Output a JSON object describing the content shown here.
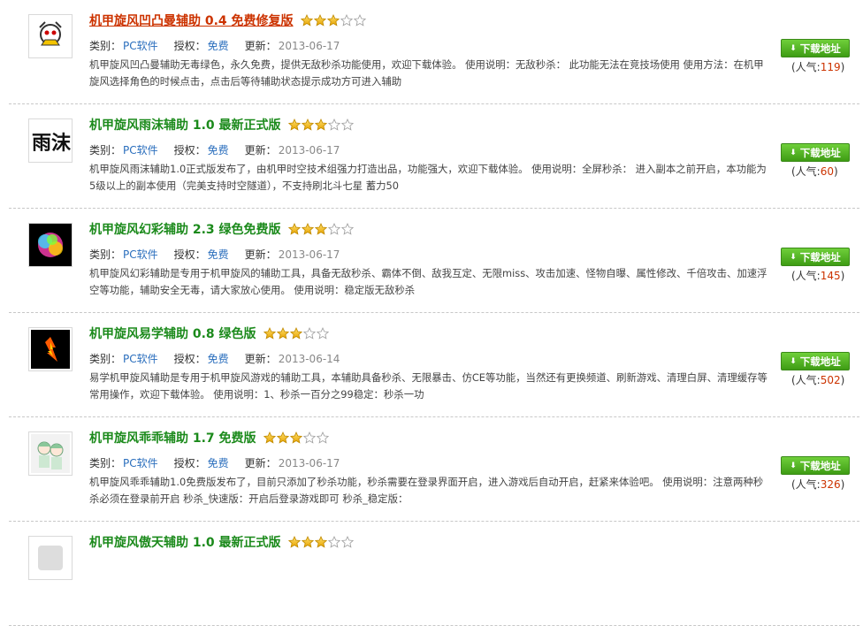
{
  "labels": {
    "category": "类别：",
    "license": "授权：",
    "updated": "更新：",
    "download": "下载地址",
    "popularity_prefix": "(人气:",
    "popularity_suffix": ")"
  },
  "items": [
    {
      "title": "机甲旋风凹凸曼辅助 0.4 免费修复版",
      "category": "PC软件",
      "license": "免费",
      "date": "2013-06-17",
      "description": "机甲旋风凹凸曼辅助无毒绿色，永久免费，提供无敌秒杀功能使用，欢迎下载体验。 使用说明：无敌秒杀： 此功能无法在竞技场使用 使用方法：在机甲旋风选择角色的时候点击，点击后等待辅助状态提示成功方可进入辅助",
      "popularity": "119",
      "rating": 3,
      "icon": "character-icon"
    },
    {
      "title": "机甲旋风雨沫辅助 1.0 最新正式版",
      "category": "PC软件",
      "license": "免费",
      "date": "2013-06-17",
      "description": "机甲旋风雨沫辅助1.0正式版发布了，由机甲时空技术组强力打造出品，功能强大，欢迎下载体验。 使用说明：全屏秒杀： 进入副本之前开启，本功能为5级以上的副本使用（完美支持时空隧道），不支持刷北斗七星 蓄力50",
      "popularity": "60",
      "rating": 3,
      "icon": "calligraphy-icon"
    },
    {
      "title": "机甲旋风幻彩辅助 2.3 绿色免费版",
      "category": "PC软件",
      "license": "免费",
      "date": "2013-06-17",
      "description": "机甲旋风幻彩辅助是专用于机甲旋风的辅助工具，具备无敌秒杀、霸体不倒、敌我互定、无限miss、攻击加速、怪物自曝、属性修改、千倍攻击、加速浮空等功能，辅助安全无毒，请大家放心使用。 使用说明：稳定版无敌秒杀",
      "popularity": "145",
      "rating": 3,
      "icon": "colorful-burst-icon"
    },
    {
      "title": "机甲旋风易学辅助 0.8 绿色版",
      "category": "PC软件",
      "license": "免费",
      "date": "2013-06-14",
      "description": "易学机甲旋风辅助是专用于机甲旋风游戏的辅助工具，本辅助具备秒杀、无限暴击、仿CE等功能，当然还有更换频道、刷新游戏、清理白屏、清理缓存等常用操作，欢迎下载体验。 使用说明：1、秒杀一百分之99稳定：秒杀一功",
      "popularity": "502",
      "rating": 3,
      "icon": "fire-figure-icon"
    },
    {
      "title": "机甲旋风乖乖辅助 1.7 免费版",
      "category": "PC软件",
      "license": "免费",
      "date": "2013-06-17",
      "description": "机甲旋风乖乖辅助1.0免费版发布了，目前只添加了秒杀功能，秒杀需要在登录界面开启，进入游戏后自动开启，赶紧来体验吧。 使用说明：注意两种秒杀必须在登录前开启 秒杀_快速版：开启后登录游戏即可 秒杀_稳定版：",
      "popularity": "326",
      "rating": 3,
      "icon": "anime-characters-icon"
    },
    {
      "title": "机甲旋风傲天辅助 1.0 最新正式版",
      "category": "",
      "license": "",
      "date": "",
      "description": "",
      "popularity": "",
      "rating": 3,
      "icon": "app-icon"
    }
  ]
}
